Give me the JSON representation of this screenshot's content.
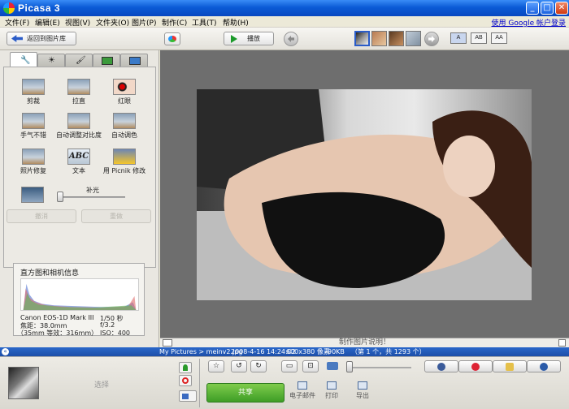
{
  "window": {
    "title": "Picasa 3"
  },
  "menu": {
    "items": [
      "文件(F)",
      "编辑(E)",
      "视图(V)",
      "文件夹(O)",
      "图片(P)",
      "制作(C)",
      "工具(T)",
      "帮助(H)"
    ],
    "signin": "使用 Google 帐户登录"
  },
  "toolbar": {
    "back_label": "返回到图片库",
    "play_label": "播放",
    "caption_modes": [
      "A",
      "AB",
      "AA"
    ]
  },
  "edit_tools": {
    "row1": [
      "剪裁",
      "拉直",
      "红眼"
    ],
    "row2": [
      "手气不错",
      "自动调整对比度",
      "自动调色"
    ],
    "row3": [
      "照片修复",
      "文本",
      "用 Picnik 修改"
    ],
    "abc_text": "ABC",
    "fill_light_label": "补光",
    "fill_light_value": 0,
    "undo_label": "撤消",
    "redo_label": "重做"
  },
  "histogram": {
    "title": "直方图和相机信息",
    "camera_model": "Canon EOS-1D Mark III",
    "focal_length": "焦距：38.0mm",
    "equiv": "（35mm 等效：316mm）",
    "shutter": "1/50 秒",
    "aperture": "f/3.2",
    "iso": "ISO：400"
  },
  "viewer": {
    "caption_placeholder": "制作图片说明！"
  },
  "status": {
    "path": "My Pictures > meinv2.jpg",
    "datetime": "2008-4-16 14:24:02",
    "dimensions": "600x380 像素",
    "size": "90KB",
    "position": "（第 1 个，共 1293 个）"
  },
  "tray": {
    "select_label": "选择",
    "share_label": "共享",
    "email_label": "电子邮件",
    "print_label": "打印",
    "export_label": "导出"
  },
  "colors": {
    "title_bar": "#0B5BD6",
    "status_bar": "#1D4FA8",
    "share_green": "#3E9E26",
    "link_blue": "#0000CC"
  }
}
